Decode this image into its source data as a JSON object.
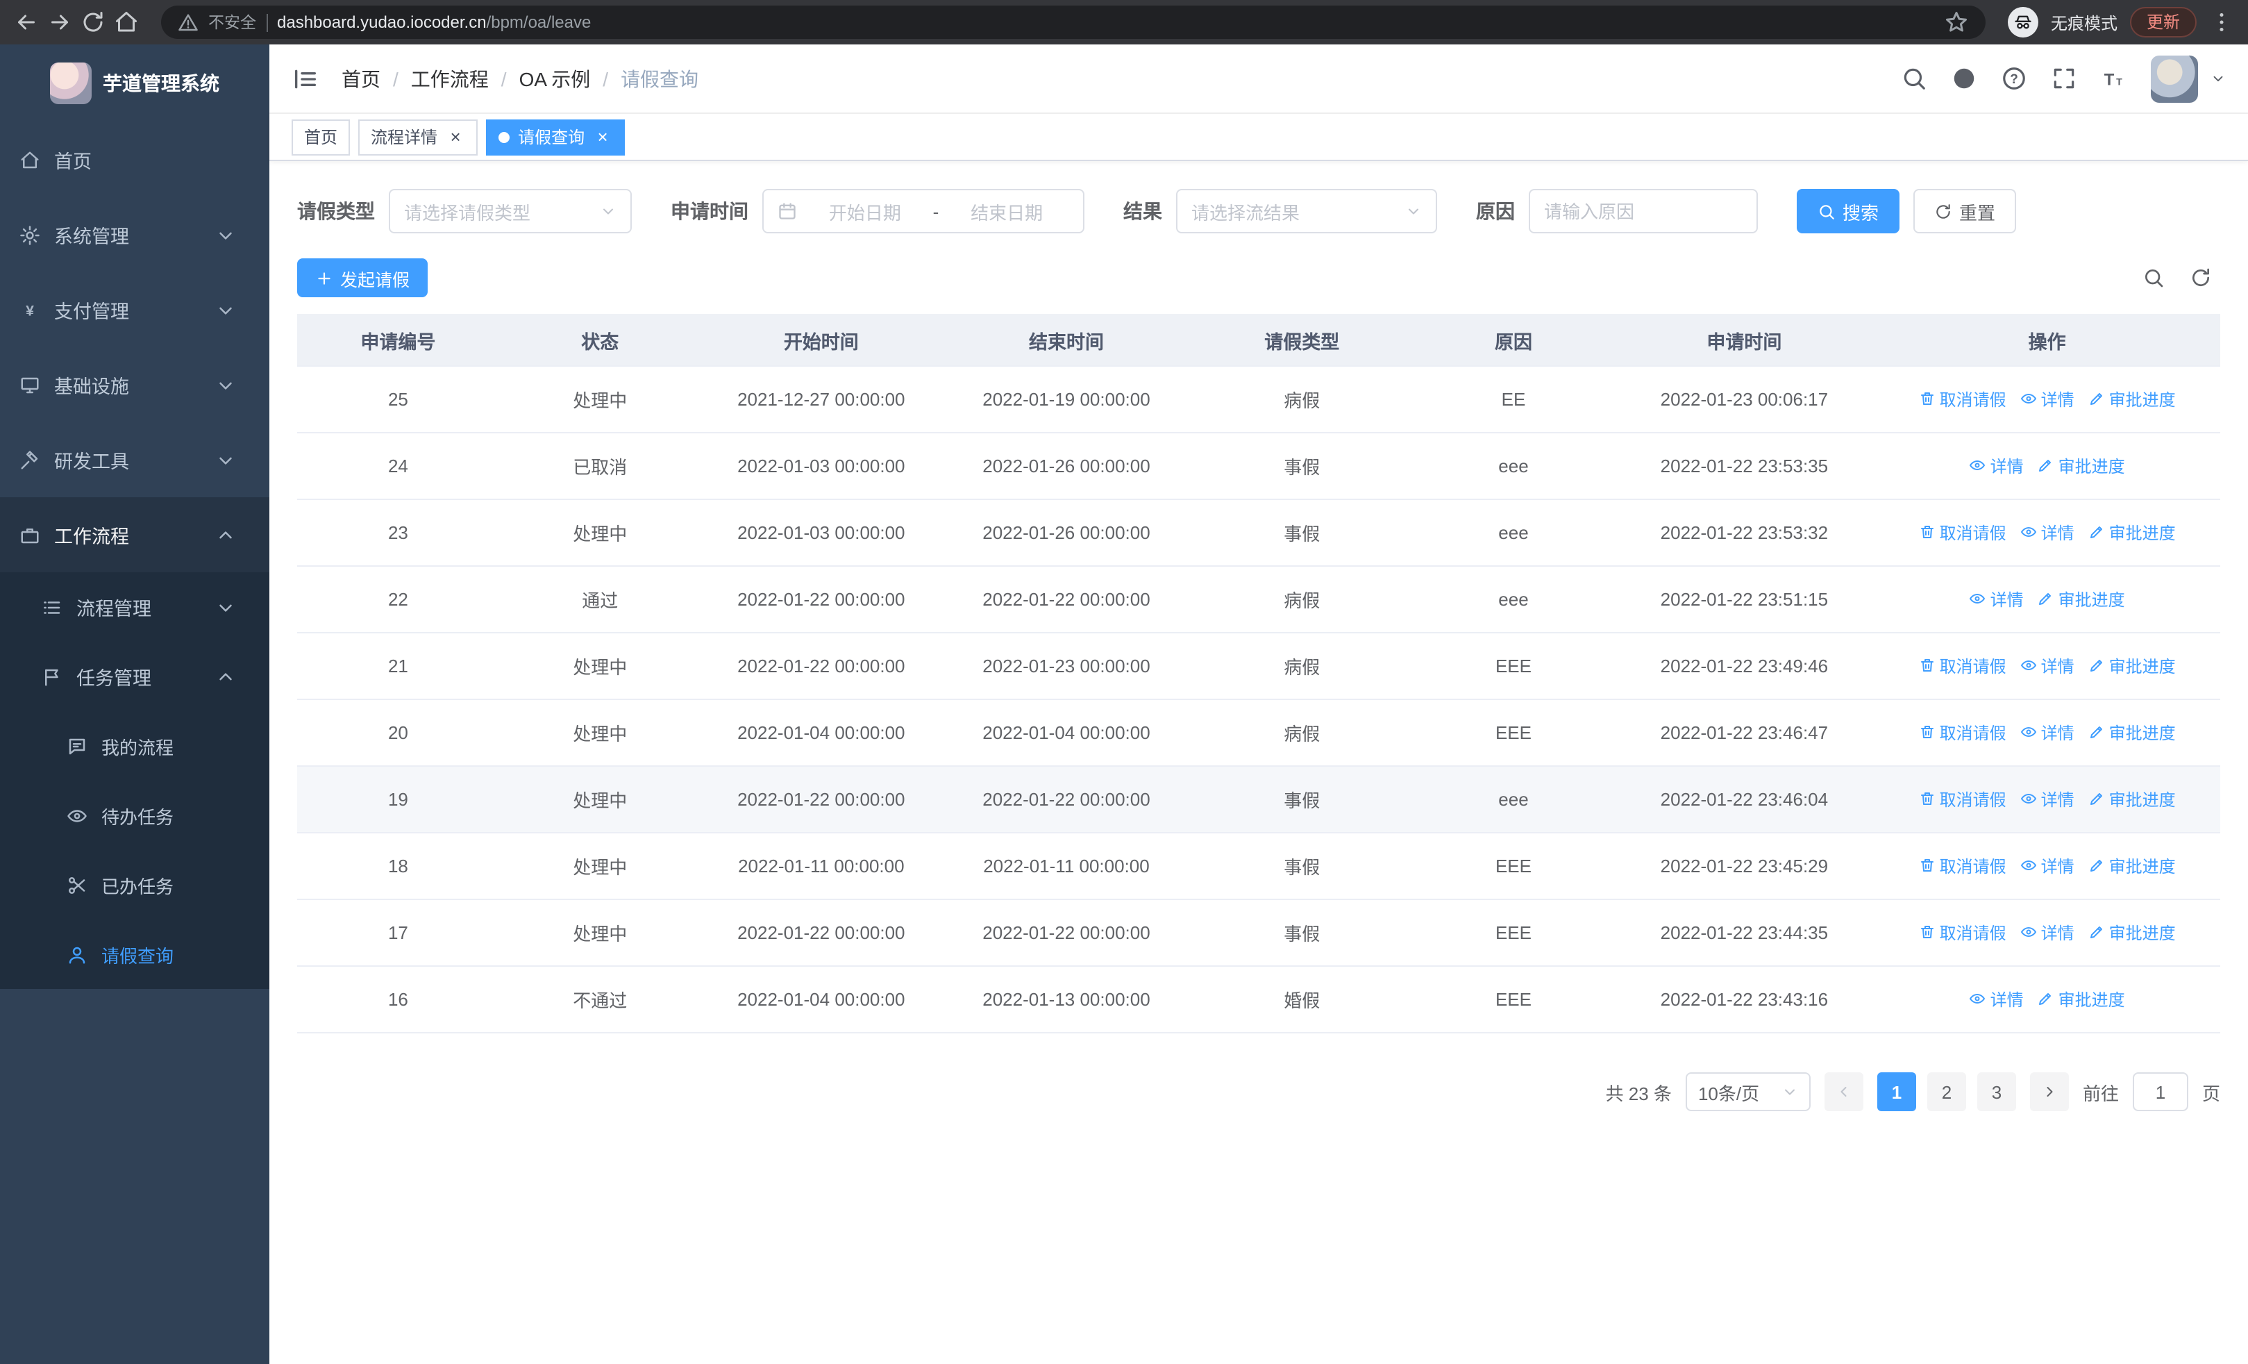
{
  "colors": {
    "accent": "#409eff",
    "sidebar_bg": "#304156",
    "submenu_bg": "#1f2d3d",
    "warning_text": "#f28b82"
  },
  "browser": {
    "security_label": "不安全",
    "url_host": "dashboard.yudao.iocoder.cn",
    "url_path": "/bpm/oa/leave",
    "incognito_label": "无痕模式",
    "update_label": "更新"
  },
  "sidebar": {
    "logo_title": "芋道管理系统",
    "items": [
      {
        "id": "home",
        "label": "首页",
        "icon": "home",
        "level": "l1"
      },
      {
        "id": "system",
        "label": "系统管理",
        "icon": "gear",
        "level": "l1",
        "chevron": "down"
      },
      {
        "id": "payment",
        "label": "支付管理",
        "icon": "yen",
        "level": "l1",
        "chevron": "down"
      },
      {
        "id": "infra",
        "label": "基础设施",
        "icon": "monitor",
        "level": "l1",
        "chevron": "down"
      },
      {
        "id": "devtools",
        "label": "研发工具",
        "icon": "tools",
        "level": "l1",
        "chevron": "down"
      },
      {
        "id": "workflow",
        "label": "工作流程",
        "icon": "briefcase",
        "level": "l1",
        "chevron": "up",
        "open": true
      },
      {
        "id": "process-mgmt",
        "label": "流程管理",
        "icon": "list",
        "level": "l2",
        "chevron": "down"
      },
      {
        "id": "task-mgmt",
        "label": "任务管理",
        "icon": "flag",
        "level": "l2",
        "chevron": "up",
        "open": true
      },
      {
        "id": "my-process",
        "label": "我的流程",
        "icon": "chat",
        "level": "l3"
      },
      {
        "id": "todo-tasks",
        "label": "待办任务",
        "icon": "eye",
        "level": "l3"
      },
      {
        "id": "done-tasks",
        "label": "已办任务",
        "icon": "scissors",
        "level": "l3"
      },
      {
        "id": "leave-query",
        "label": "请假查询",
        "icon": "user",
        "level": "l3",
        "active": true
      }
    ]
  },
  "header": {
    "breadcrumbs": [
      "首页",
      "工作流程",
      "OA 示例",
      "请假查询"
    ],
    "separator": "/"
  },
  "tabs": [
    {
      "id": "home",
      "label": "首页",
      "closable": false,
      "active": false
    },
    {
      "id": "process-detail",
      "label": "流程详情",
      "closable": true,
      "active": false
    },
    {
      "id": "leave-query",
      "label": "请假查询",
      "closable": true,
      "active": true
    }
  ],
  "filters": {
    "leave_type_label": "请假类型",
    "leave_type_placeholder": "请选择请假类型",
    "apply_time_label": "申请时间",
    "start_date_placeholder": "开始日期",
    "date_separator": "-",
    "end_date_placeholder": "结束日期",
    "result_label": "结果",
    "result_placeholder": "请选择流结果",
    "reason_label": "原因",
    "reason_placeholder": "请输入原因",
    "search_label": "搜索",
    "reset_label": "重置"
  },
  "toolbar": {
    "create_label": "发起请假"
  },
  "table": {
    "columns": [
      "申请编号",
      "状态",
      "开始时间",
      "结束时间",
      "请假类型",
      "原因",
      "申请时间",
      "操作"
    ],
    "action_labels": {
      "cancel": "取消请假",
      "detail": "详情",
      "progress": "审批进度"
    },
    "rows": [
      {
        "id": "25",
        "status": "处理中",
        "start": "2021-12-27 00:00:00",
        "end": "2022-01-19 00:00:00",
        "type": "病假",
        "reason": "EE",
        "applied": "2022-01-23 00:06:17",
        "actions": [
          "cancel",
          "detail",
          "progress"
        ],
        "highlight": false
      },
      {
        "id": "24",
        "status": "已取消",
        "start": "2022-01-03 00:00:00",
        "end": "2022-01-26 00:00:00",
        "type": "事假",
        "reason": "eee",
        "applied": "2022-01-22 23:53:35",
        "actions": [
          "detail",
          "progress"
        ],
        "highlight": false
      },
      {
        "id": "23",
        "status": "处理中",
        "start": "2022-01-03 00:00:00",
        "end": "2022-01-26 00:00:00",
        "type": "事假",
        "reason": "eee",
        "applied": "2022-01-22 23:53:32",
        "actions": [
          "cancel",
          "detail",
          "progress"
        ],
        "highlight": false
      },
      {
        "id": "22",
        "status": "通过",
        "start": "2022-01-22 00:00:00",
        "end": "2022-01-22 00:00:00",
        "type": "病假",
        "reason": "eee",
        "applied": "2022-01-22 23:51:15",
        "actions": [
          "detail",
          "progress"
        ],
        "highlight": false
      },
      {
        "id": "21",
        "status": "处理中",
        "start": "2022-01-22 00:00:00",
        "end": "2022-01-23 00:00:00",
        "type": "病假",
        "reason": "EEE",
        "applied": "2022-01-22 23:49:46",
        "actions": [
          "cancel",
          "detail",
          "progress"
        ],
        "highlight": false
      },
      {
        "id": "20",
        "status": "处理中",
        "start": "2022-01-04 00:00:00",
        "end": "2022-01-04 00:00:00",
        "type": "病假",
        "reason": "EEE",
        "applied": "2022-01-22 23:46:47",
        "actions": [
          "cancel",
          "detail",
          "progress"
        ],
        "highlight": false
      },
      {
        "id": "19",
        "status": "处理中",
        "start": "2022-01-22 00:00:00",
        "end": "2022-01-22 00:00:00",
        "type": "事假",
        "reason": "eee",
        "applied": "2022-01-22 23:46:04",
        "actions": [
          "cancel",
          "detail",
          "progress"
        ],
        "highlight": true
      },
      {
        "id": "18",
        "status": "处理中",
        "start": "2022-01-11 00:00:00",
        "end": "2022-01-11 00:00:00",
        "type": "事假",
        "reason": "EEE",
        "applied": "2022-01-22 23:45:29",
        "actions": [
          "cancel",
          "detail",
          "progress"
        ],
        "highlight": false
      },
      {
        "id": "17",
        "status": "处理中",
        "start": "2022-01-22 00:00:00",
        "end": "2022-01-22 00:00:00",
        "type": "事假",
        "reason": "EEE",
        "applied": "2022-01-22 23:44:35",
        "actions": [
          "cancel",
          "detail",
          "progress"
        ],
        "highlight": false
      },
      {
        "id": "16",
        "status": "不通过",
        "start": "2022-01-04 00:00:00",
        "end": "2022-01-13 00:00:00",
        "type": "婚假",
        "reason": "EEE",
        "applied": "2022-01-22 23:43:16",
        "actions": [
          "detail",
          "progress"
        ],
        "highlight": false
      }
    ]
  },
  "pagination": {
    "total_label": "共 23 条",
    "page_size_label": "10条/页",
    "pages": [
      "1",
      "2",
      "3"
    ],
    "active_page": "1",
    "goto_label": "前往",
    "goto_value": "1",
    "page_suffix": "页"
  }
}
